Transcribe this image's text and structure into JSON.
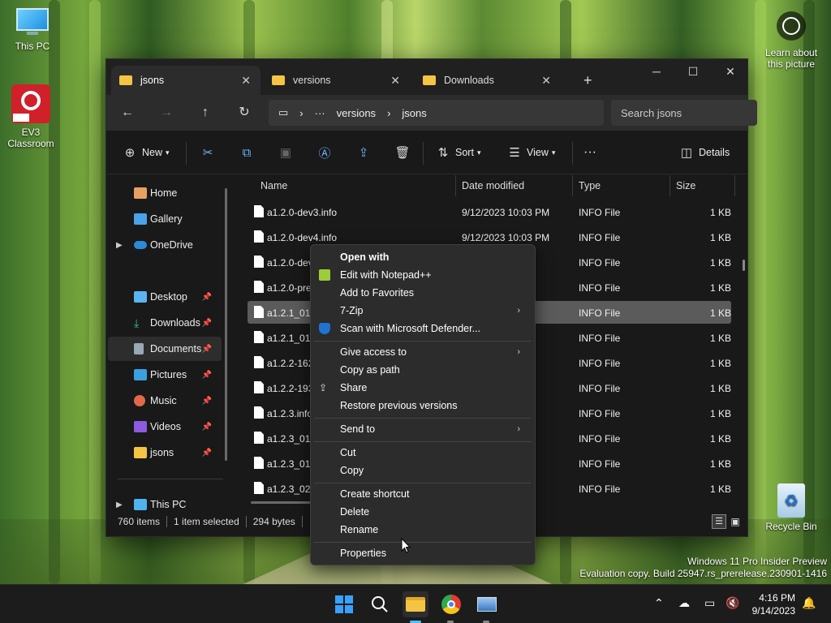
{
  "desktop": {
    "icons": [
      {
        "label": "This PC"
      },
      {
        "label": "EV3 Classroom"
      },
      {
        "label": "Recycle Bin"
      }
    ],
    "spotlight": "Learn about this picture",
    "watermark_line1": "Windows 11 Pro Insider Preview",
    "watermark_line2": "Evaluation copy. Build 25947.rs_prerelease.230901-1416"
  },
  "explorer": {
    "tabs": [
      {
        "label": "jsons",
        "active": true
      },
      {
        "label": "versions",
        "active": false
      },
      {
        "label": "Downloads",
        "active": false
      }
    ],
    "breadcrumb": [
      "versions",
      "jsons"
    ],
    "search_placeholder": "Search jsons",
    "toolbar": {
      "new": "New",
      "sort": "Sort",
      "view": "View",
      "details": "Details"
    },
    "nav": [
      {
        "label": "Home"
      },
      {
        "label": "Gallery"
      },
      {
        "label": "OneDrive"
      },
      {
        "label": "Desktop"
      },
      {
        "label": "Downloads"
      },
      {
        "label": "Documents"
      },
      {
        "label": "Pictures"
      },
      {
        "label": "Music"
      },
      {
        "label": "Videos"
      },
      {
        "label": "jsons"
      },
      {
        "label": "This PC"
      }
    ],
    "columns": [
      "Name",
      "Date modified",
      "Type",
      "Size"
    ],
    "rows": [
      {
        "name": "a1.2.0-dev3.info",
        "date": "9/12/2023 10:03 PM",
        "type": "INFO File",
        "size": "1 KB"
      },
      {
        "name": "a1.2.0-dev4.info",
        "date": "9/12/2023 10:03 PM",
        "type": "INFO File",
        "size": "1 KB"
      },
      {
        "name": "a1.2.0-dev",
        "date": "M",
        "type": "INFO File",
        "size": "1 KB"
      },
      {
        "name": "a1.2.0-prev",
        "date": "M",
        "type": "INFO File",
        "size": "1 KB"
      },
      {
        "name": "a1.2.1_01 -",
        "date": "M",
        "type": "INFO File",
        "size": "1 KB"
      },
      {
        "name": "a1.2.1_01.i",
        "date": "M",
        "type": "INFO File",
        "size": "1 KB"
      },
      {
        "name": "a1.2.2-162",
        "date": "M",
        "type": "INFO File",
        "size": "1 KB"
      },
      {
        "name": "a1.2.2-193",
        "date": "M",
        "type": "INFO File",
        "size": "1 KB"
      },
      {
        "name": "a1.2.3.info",
        "date": "M",
        "type": "INFO File",
        "size": "1 KB"
      },
      {
        "name": "a1.2.3_01-0",
        "date": "M",
        "type": "INFO File",
        "size": "1 KB"
      },
      {
        "name": "a1.2.3_01-0",
        "date": "M",
        "type": "INFO File",
        "size": "1 KB"
      },
      {
        "name": "a1.2.3_02.i",
        "date": "M",
        "type": "INFO File",
        "size": "1 KB"
      }
    ],
    "status": {
      "count": "760 items",
      "selected": "1 item selected",
      "bytes": "294 bytes"
    }
  },
  "context_menu": [
    {
      "label": "Open with"
    },
    {
      "label": "Edit with Notepad++"
    },
    {
      "label": "Add to Favorites"
    },
    {
      "label": "7-Zip"
    },
    {
      "label": "Scan with Microsoft Defender..."
    },
    {
      "label": "Give access to"
    },
    {
      "label": "Copy as path"
    },
    {
      "label": "Share"
    },
    {
      "label": "Restore previous versions"
    },
    {
      "label": "Send to"
    },
    {
      "label": "Cut"
    },
    {
      "label": "Copy"
    },
    {
      "label": "Create shortcut"
    },
    {
      "label": "Delete"
    },
    {
      "label": "Rename"
    },
    {
      "label": "Properties"
    }
  ],
  "taskbar": {
    "time": "4:16 PM",
    "date": "9/14/2023"
  },
  "colors": {
    "accent": "#0078d4",
    "folder": "#f5c445",
    "window_bg": "#191919",
    "menu_bg": "#2c2c2c"
  }
}
